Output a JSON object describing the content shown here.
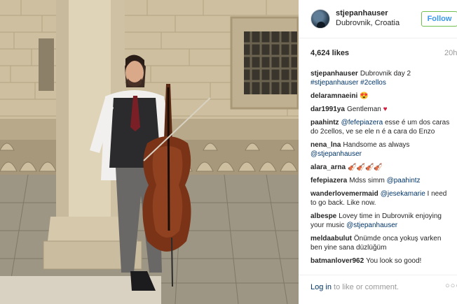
{
  "post": {
    "username": "stjepanhauser",
    "location": "Dubrovnik, Croatia",
    "follow_label": "Follow",
    "likes": "4,624 likes",
    "time": "20h"
  },
  "comments": [
    {
      "user": "stjepanhauser",
      "parts": [
        {
          "t": "Dubrovnik day 2 "
        },
        {
          "t": "#stjepanhauser",
          "link": true
        },
        {
          "t": " "
        },
        {
          "t": "#2cellos",
          "link": true
        }
      ]
    },
    {
      "user": "delaramnaeini",
      "parts": [
        {
          "t": "😍"
        }
      ]
    },
    {
      "user": "dar1991ya",
      "parts": [
        {
          "t": "Gentleman "
        },
        {
          "t": "♥",
          "heart": true
        }
      ]
    },
    {
      "user": "paahintz",
      "parts": [
        {
          "t": "@fefepiazera",
          "link": true
        },
        {
          "t": " esse é um dos caras do 2cellos, ve se ele n é a cara do Enzo"
        }
      ]
    },
    {
      "user": "nena_lna",
      "parts": [
        {
          "t": "Handsome as always "
        },
        {
          "t": "@stjepanhauser",
          "link": true
        }
      ]
    },
    {
      "user": "alara_arna",
      "parts": [
        {
          "t": "🎻🎻🎻🎻"
        }
      ]
    },
    {
      "user": "fefepiazera",
      "parts": [
        {
          "t": "Mdss simm "
        },
        {
          "t": "@paahintz",
          "link": true
        }
      ]
    },
    {
      "user": "wanderlovemermaid",
      "parts": [
        {
          "t": "@jesekamarie",
          "link": true
        },
        {
          "t": " I need to go back. Like now."
        }
      ]
    },
    {
      "user": "albespe",
      "parts": [
        {
          "t": "Lovey time in Dubrovnik enjoying your music "
        },
        {
          "t": "@stjepanhauser",
          "link": true
        }
      ]
    },
    {
      "user": "meldaabulut",
      "parts": [
        {
          "t": "Önümde onca yokuş varken ben yine sana düzlüğüm"
        }
      ]
    },
    {
      "user": "batmanlover962",
      "parts": [
        {
          "t": "You look so good!"
        }
      ]
    }
  ],
  "footer": {
    "login_label": "Log in",
    "rest": " to like or comment.",
    "more_label": "○○○"
  },
  "colors": {
    "link": "#003569",
    "follow_text": "#3897f0",
    "follow_border": "#70c050",
    "heart": "#d41c3c"
  },
  "icons": [
    "avatar",
    "heart-emoji",
    "cello-emoji",
    "more-options-icon"
  ]
}
